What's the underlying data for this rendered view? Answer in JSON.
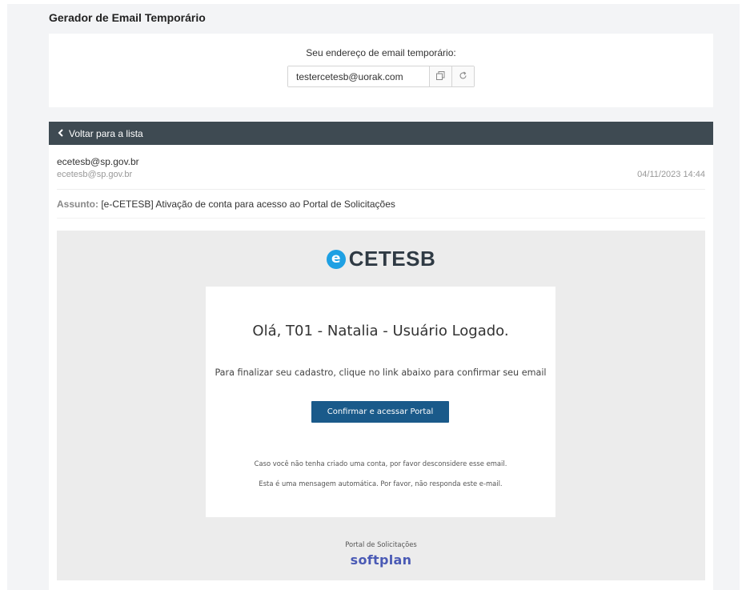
{
  "app": {
    "title": "Gerador de Email Temporário"
  },
  "address": {
    "label": "Seu endereço de email temporário:",
    "value": "testercetesb@uorak.com",
    "copy_icon": "copy-icon",
    "refresh_icon": "refresh-icon"
  },
  "nav": {
    "back_label": "Voltar para a lista",
    "back_icon": "chevron-left-icon"
  },
  "message": {
    "from_name": "ecetesb@sp.gov.br",
    "from_email": "ecetesb@sp.gov.br",
    "date": "04/11/2023 14:44",
    "subject_label": "Assunto:",
    "subject": "[e-CETESB] Ativação de conta para acesso ao Portal de Solicitações"
  },
  "email": {
    "brand_letter": "e",
    "brand_name": "CETESB",
    "greeting": "Olá, T01 - Natalia - Usuário Logado.",
    "instruction": "Para finalizar seu cadastro, clique no link abaixo para confirmar seu email",
    "button_label": "Confirmar e acessar Portal",
    "note1": "Caso você não tenha criado uma conta, por favor desconsidere esse email.",
    "note2": "Esta é uma mensagem automática. Por favor, não responda este e-mail.",
    "footer_label": "Portal de Solicitações",
    "footer_brand": "softplan"
  },
  "colors": {
    "header_bar": "#3e4a52",
    "button": "#1a5a8a",
    "brand_blue": "#1ea0e3",
    "softplan": "#4a5ab5"
  }
}
